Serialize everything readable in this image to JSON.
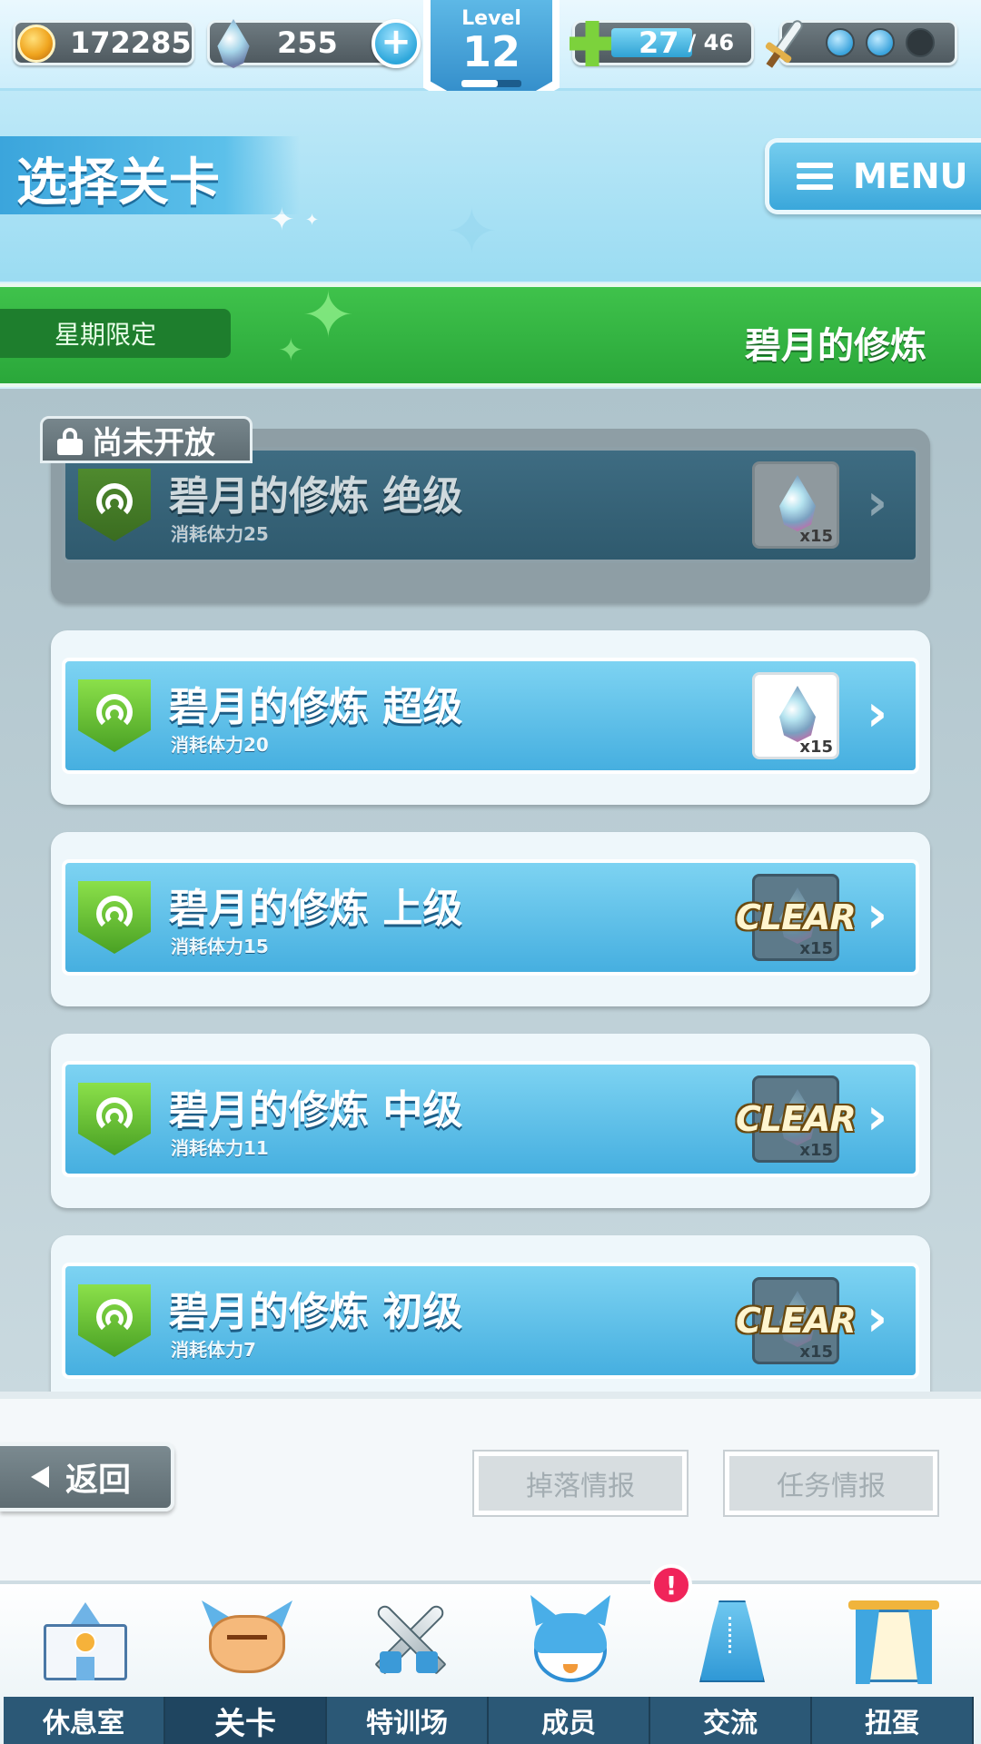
{
  "status": {
    "coins": "172285",
    "gems": "255",
    "stamina_current": "27",
    "stamina_max": "/ 46",
    "stamina_fraction": 0.59,
    "level_label": "Level",
    "level_value": "12",
    "level_progress": 0.6,
    "sword_charges_filled": 2,
    "sword_charges_total": 3,
    "icons": [
      "coin-icon",
      "gem-icon",
      "plus-icon",
      "stamina-cross-icon",
      "sword-icon"
    ]
  },
  "header": {
    "title": "选择关卡",
    "menu_label": "MENU"
  },
  "band": {
    "tag": "星期限定",
    "stage_title": "碧月的修炼"
  },
  "lock_label": "尚未开放",
  "stages": [
    {
      "name": "碧月的修炼  绝级",
      "cost": "消耗体力25",
      "reward_qty": "x15",
      "state": "locked",
      "clear": ""
    },
    {
      "name": "碧月的修炼  超级",
      "cost": "消耗体力20",
      "reward_qty": "x15",
      "state": "open",
      "clear": ""
    },
    {
      "name": "碧月的修炼  上级",
      "cost": "消耗体力15",
      "reward_qty": "x15",
      "state": "cleared",
      "clear": "CLEAR"
    },
    {
      "name": "碧月的修炼  中级",
      "cost": "消耗体力11",
      "reward_qty": "x15",
      "state": "cleared",
      "clear": "CLEAR"
    },
    {
      "name": "碧月的修炼  初级",
      "cost": "消耗体力7",
      "reward_qty": "x15",
      "state": "cleared",
      "clear": "CLEAR"
    }
  ],
  "actions": {
    "back": "返回",
    "drop_info": "掉落情报",
    "quest_info": "任务情报"
  },
  "nav": {
    "items": [
      {
        "label": "休息室",
        "icon": "school-icon"
      },
      {
        "label": "关卡",
        "icon": "monster-icon",
        "active": true
      },
      {
        "label": "特训场",
        "icon": "crossed-swords-icon"
      },
      {
        "label": "成员",
        "icon": "cat-girl-icon"
      },
      {
        "label": "交流",
        "icon": "dress-icon"
      },
      {
        "label": "扭蛋",
        "icon": "curtain-icon"
      }
    ],
    "notification": "!"
  },
  "colors": {
    "accent_blue": "#46afe0",
    "green_band": "#2aa73a",
    "nav_label": "#2b5876",
    "notification": "#f0245a"
  }
}
